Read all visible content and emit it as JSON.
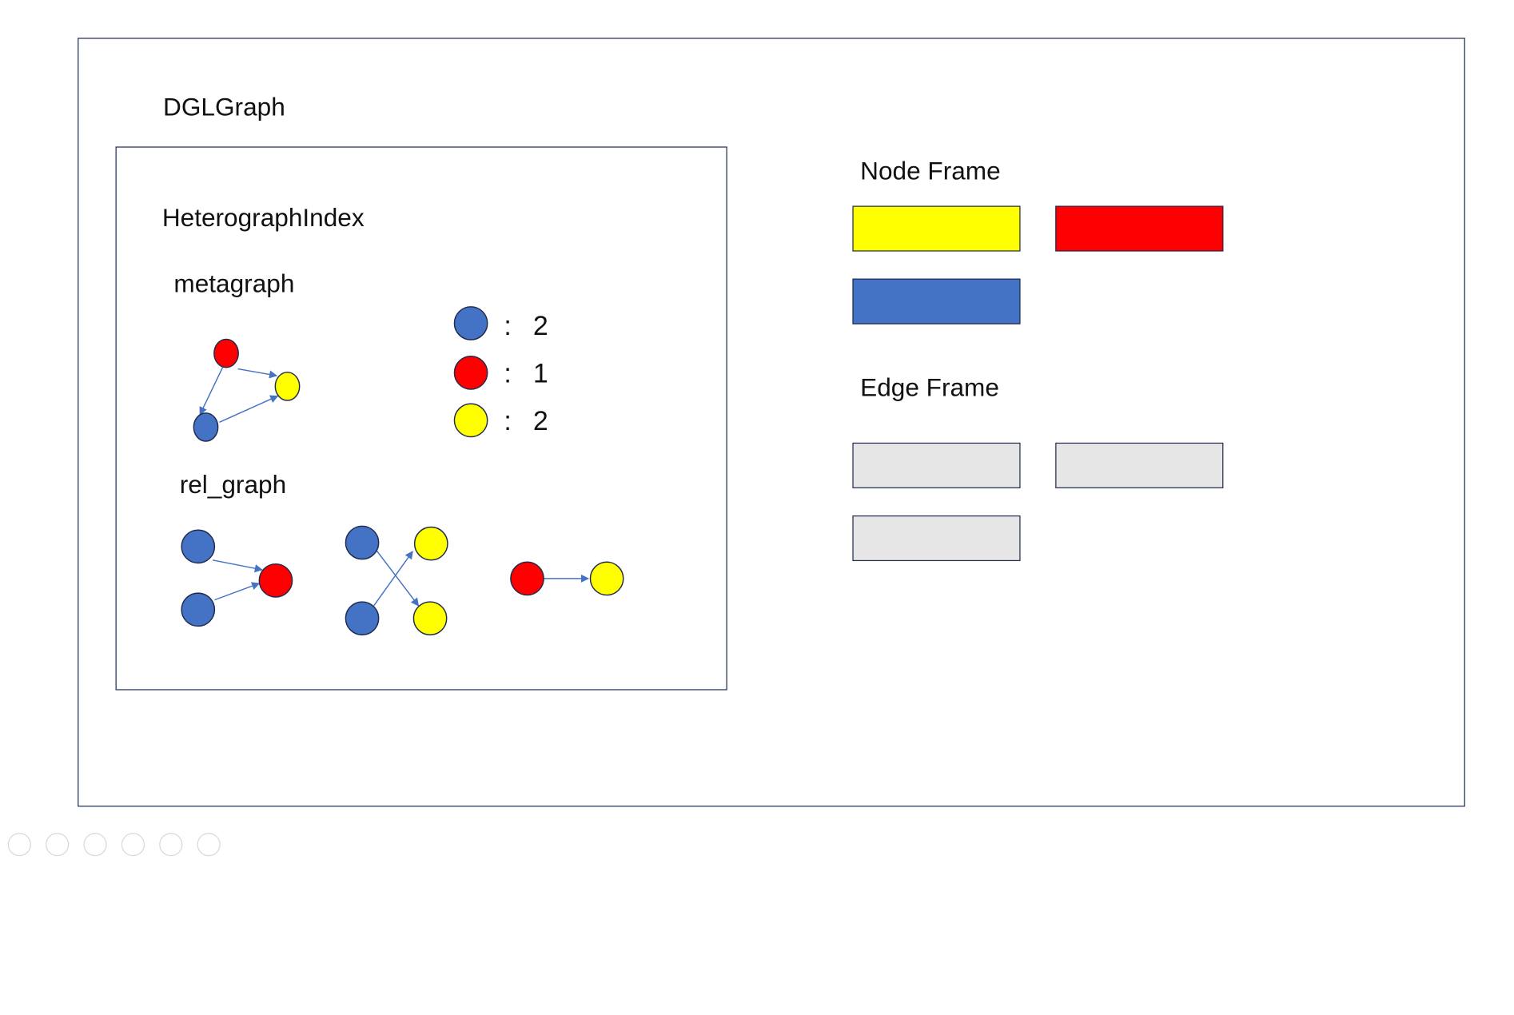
{
  "title": "DGLGraph",
  "heterograph_index": {
    "title": "HeterographIndex",
    "metagraph_label": "metagraph",
    "rel_graph_label": "rel_graph"
  },
  "legend": [
    {
      "color": "#4472c4",
      "sep": ":",
      "count": "2"
    },
    {
      "color": "#ff0000",
      "sep": ":",
      "count": "1"
    },
    {
      "color": "#ffff00",
      "sep": ":",
      "count": "2"
    }
  ],
  "node_frame": {
    "label": "Node Frame",
    "boxes": [
      "#ffff00",
      "#ff0000",
      "#4472c4"
    ]
  },
  "edge_frame": {
    "label": "Edge Frame",
    "boxes": [
      "#e6e6e6",
      "#e6e6e6",
      "#e6e6e6"
    ]
  },
  "colors": {
    "blue": "#4472c4",
    "red": "#ff0000",
    "yellow": "#ffff00",
    "edge": "#4472c4",
    "border": "#1f2a4d"
  }
}
